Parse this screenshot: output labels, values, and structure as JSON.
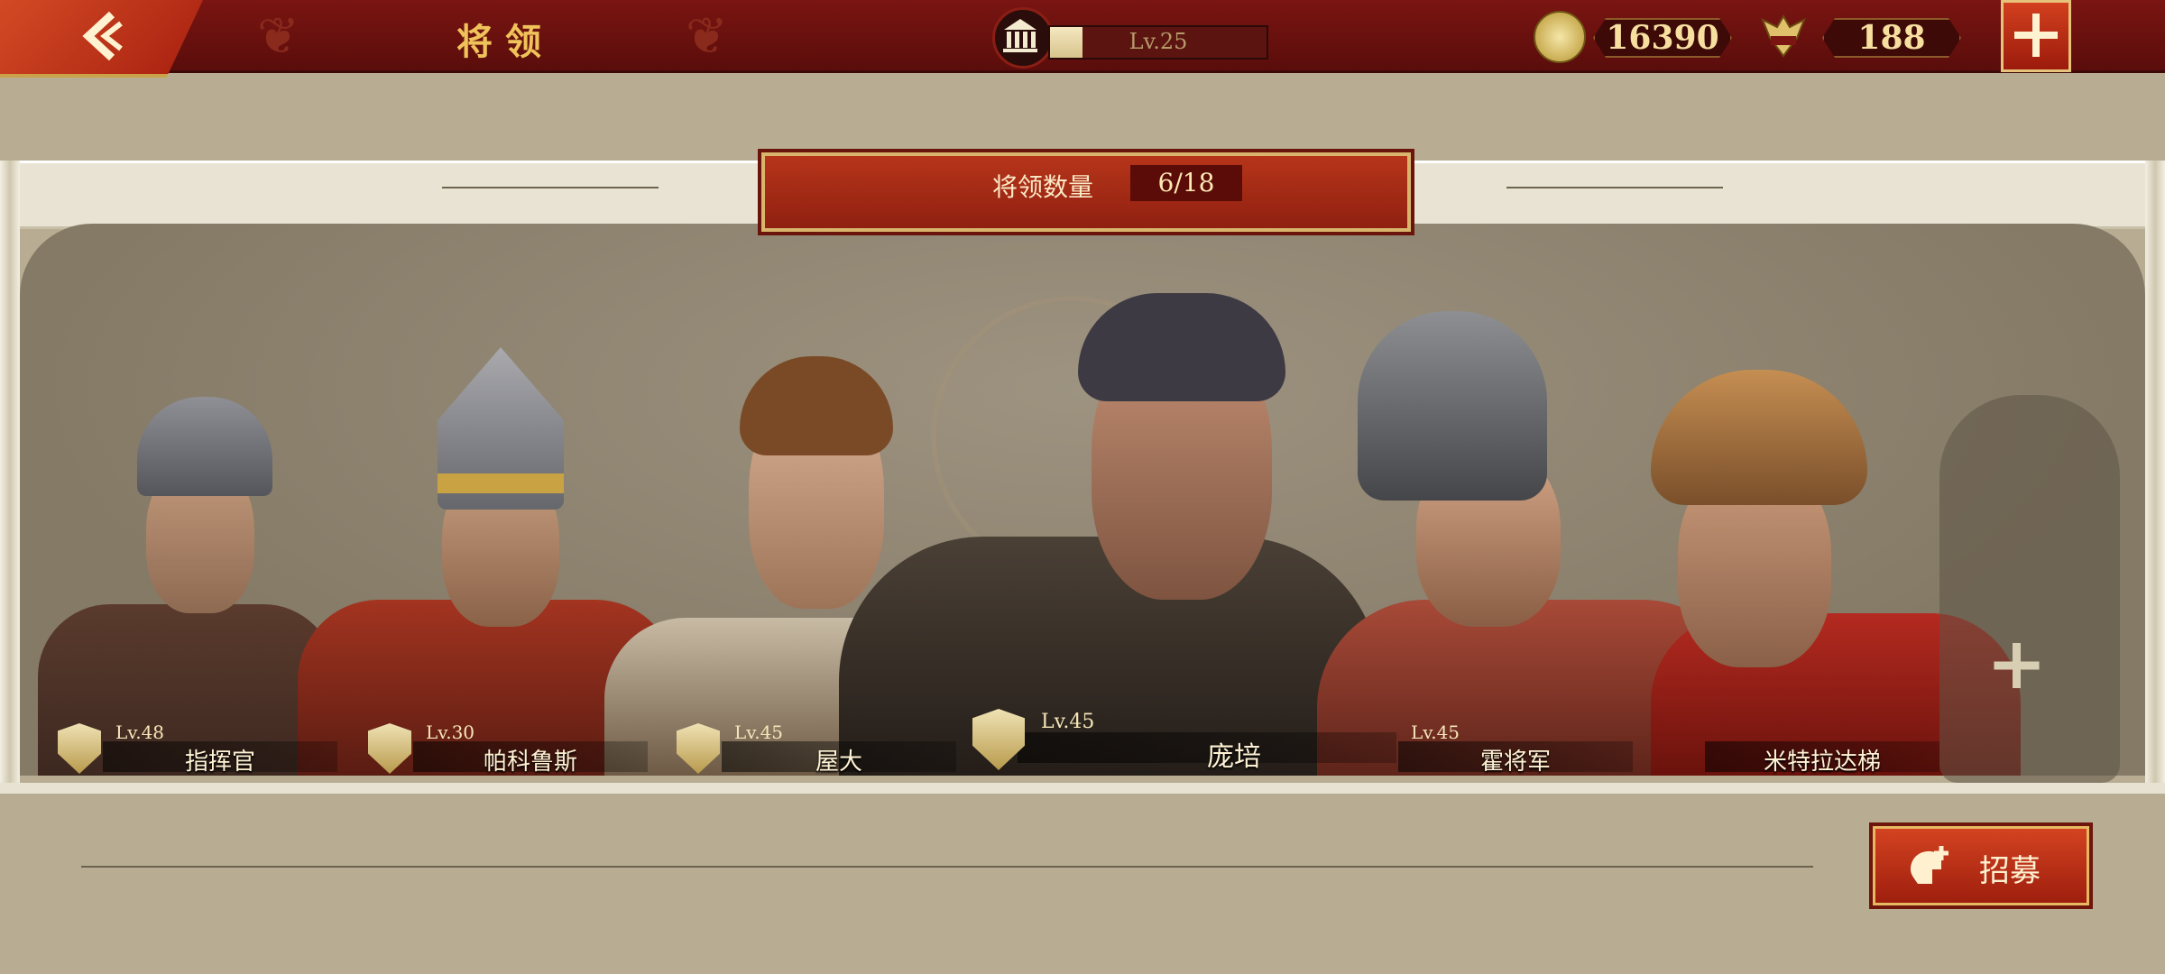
{
  "header": {
    "title": "将领",
    "level_text": "Lv.25",
    "level_progress": 0.15,
    "coins": "16390",
    "tokens": "188"
  },
  "panel": {
    "count_label": "将领数量",
    "count_value": "6/18"
  },
  "generals": [
    {
      "level": "Lv.48",
      "name": "指挥官"
    },
    {
      "level": "Lv.30",
      "name": "帕科鲁斯"
    },
    {
      "level": "Lv.45",
      "name": "屋大"
    },
    {
      "level": "Lv.45",
      "name": "庞培"
    },
    {
      "level": "Lv.45",
      "name": "霍将军"
    },
    {
      "level": "",
      "name": "米特拉达梯"
    }
  ],
  "actions": {
    "recruit_label": "招募",
    "add_symbol": "+"
  },
  "icons": [
    "back-arrow-icon",
    "temple-icon",
    "coin-icon",
    "spqr-eagle-icon",
    "plus-icon",
    "shield-rank-icon",
    "spartan-helmet-icon"
  ],
  "colors": {
    "accent_red": "#a8200f",
    "gold": "#f0c35a",
    "panel": "#847a66"
  }
}
